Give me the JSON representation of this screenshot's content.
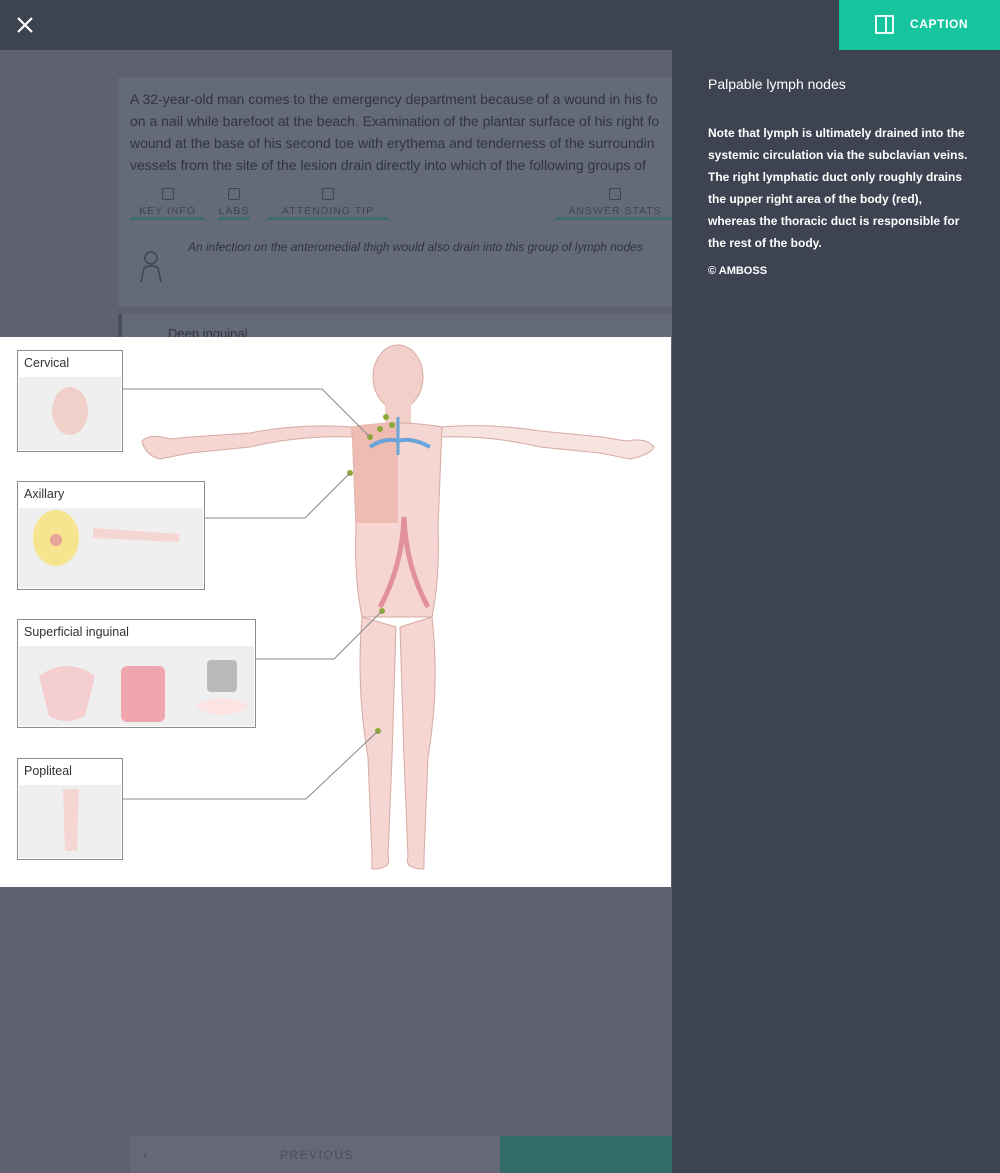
{
  "topbar": {
    "close_icon": "close-icon",
    "caption_label": "CAPTION",
    "caption_icon": "sidebar-panel-icon",
    "accent": "#16c59d"
  },
  "question": {
    "lines": [
      "A 32-year-old man comes to the emergency department because of a wound in his fo",
      "on a nail while barefoot at the beach. Examination of the plantar surface of his right fo",
      "wound at the base of his second toe with erythema and tenderness of the surroundin",
      "vessels from the site of the lesion drain directly into which of the following groups of"
    ],
    "tabs": [
      "KEY INFO",
      "LABS",
      "ATTENDING TIP",
      "ANSWER STATS"
    ],
    "hint": "An infection on the anteromedial thigh would also drain into this group of lymph nodes",
    "option_label": "Deep inguinal",
    "previous_label": "PREVIOUS"
  },
  "diagram": {
    "callouts": [
      {
        "label": "Cervical"
      },
      {
        "label": "Axillary"
      },
      {
        "label": "Superficial inguinal"
      },
      {
        "label": "Popliteal"
      }
    ],
    "colors": {
      "skin": "#f5d6d2",
      "skin_dark": "#eebcb3",
      "node": "#8fa83a",
      "vessel_blue": "#6aa4d8",
      "vessel_red": "#e0919a",
      "leader": "#888888"
    }
  },
  "caption": {
    "title": "Palpable lymph nodes",
    "body": "Note that lymph is ultimately drained into the systemic circulation via the subclavian veins. The right lymphatic duct only roughly drains the upper right area of the body (red), whereas the thoracic duct is responsible for the rest of the body.",
    "copyright": "© AMBOSS"
  }
}
